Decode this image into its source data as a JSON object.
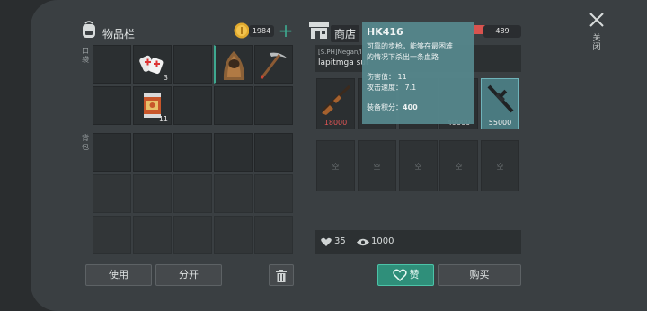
{
  "inventory": {
    "title": "物品栏",
    "coins": "1984",
    "pockets_label": "口袋",
    "backpack_label": "背包",
    "items": [
      {
        "icon": "medkit-icon",
        "qty": "3"
      },
      {
        "icon": "ghillie-hood-icon",
        "qty": ""
      },
      {
        "icon": "pickaxe-icon",
        "qty": ""
      },
      {
        "icon": "canned-food-icon",
        "qty": "11"
      }
    ],
    "use_label": "使用",
    "split_label": "分开"
  },
  "shop": {
    "tab_label": "商店",
    "currency_amount": "489",
    "seller": "[S.PH]Negan/I",
    "description": "lapitmga sul",
    "slots": [
      {
        "icon": "shotgun-icon",
        "price": "18000",
        "color": "#e05555"
      },
      {
        "icon": "",
        "price": "",
        "color": "#e0e0e0"
      },
      {
        "icon": "",
        "price": "",
        "color": "#e0e0e0"
      },
      {
        "icon": "",
        "price": "49000",
        "color": "#e0e0e0"
      },
      {
        "icon": "assault-rifle-icon",
        "price": "55000",
        "color": "#e0e0e0"
      }
    ],
    "empty_label": "空",
    "likes": "35",
    "views": "1000",
    "like_label": "赞",
    "buy_label": "购买"
  },
  "tooltip": {
    "name": "HK416",
    "desc_line1": "可靠的步枪，能够在最困难",
    "desc_line2": "的情况下杀出一条血路",
    "damage_label": "伤害值：",
    "damage_value": "11",
    "speed_label": "攻击速度：",
    "speed_value": "7.1",
    "score_label": "装备积分：",
    "score_value": "400"
  },
  "close_label": "关闭",
  "colors": {
    "accent": "#3ea88f",
    "tooltip_bg": "#55878c",
    "price_red": "#e05555",
    "frame": "#3a3f42"
  }
}
